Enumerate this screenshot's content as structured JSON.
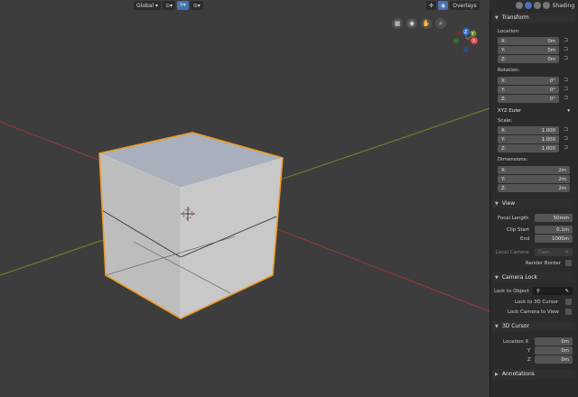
{
  "header": {
    "orientation": "Global",
    "overlays": "Overlays",
    "shading": "Shading"
  },
  "gizmo": {
    "z": "Z",
    "y": "Y",
    "x": "X"
  },
  "transform": {
    "title": "Transform",
    "location_label": "Location:",
    "location": [
      {
        "axis": "X:",
        "value": "0m"
      },
      {
        "axis": "Y:",
        "value": "0m"
      },
      {
        "axis": "Z:",
        "value": "0m"
      }
    ],
    "rotation_label": "Rotation:",
    "rotation": [
      {
        "axis": "X:",
        "value": "0°"
      },
      {
        "axis": "Y:",
        "value": "0°"
      },
      {
        "axis": "Z:",
        "value": "0°"
      }
    ],
    "rotation_mode": "XYZ Euler",
    "scale_label": "Scale:",
    "scale": [
      {
        "axis": "X:",
        "value": "1.000"
      },
      {
        "axis": "Y:",
        "value": "1.000"
      },
      {
        "axis": "Z:",
        "value": "1.000"
      }
    ],
    "dimensions_label": "Dimensions:",
    "dimensions": [
      {
        "axis": "X:",
        "value": "2m"
      },
      {
        "axis": "Y:",
        "value": "2m"
      },
      {
        "axis": "Z:",
        "value": "2m"
      }
    ]
  },
  "view": {
    "title": "View",
    "focal_length_label": "Focal Length",
    "focal_length": "50mm",
    "clip_start_label": "Clip Start",
    "clip_start": "0.1m",
    "clip_end_label": "End",
    "clip_end": "1000m",
    "local_camera_label": "Local Camera",
    "local_camera_value": "Cam...",
    "render_border_label": "Render Border"
  },
  "camera_lock": {
    "title": "Camera Lock",
    "lock_to_object_label": "Lock to Object",
    "lock_to_cursor_label": "Lock to 3D Cursor",
    "lock_camera_label": "Lock Camera to View"
  },
  "cursor3d": {
    "title": "3D Cursor",
    "fields": [
      {
        "axis": "Location X",
        "value": "0m"
      },
      {
        "axis": "Y",
        "value": "0m"
      },
      {
        "axis": "Z",
        "value": "0m"
      }
    ]
  },
  "annotations": {
    "title": "Annotations"
  },
  "colors": {
    "x_axis": "#c23a3a",
    "y_axis": "#7ea02c",
    "selection": "#f09a24",
    "accent": "#4772b3"
  }
}
